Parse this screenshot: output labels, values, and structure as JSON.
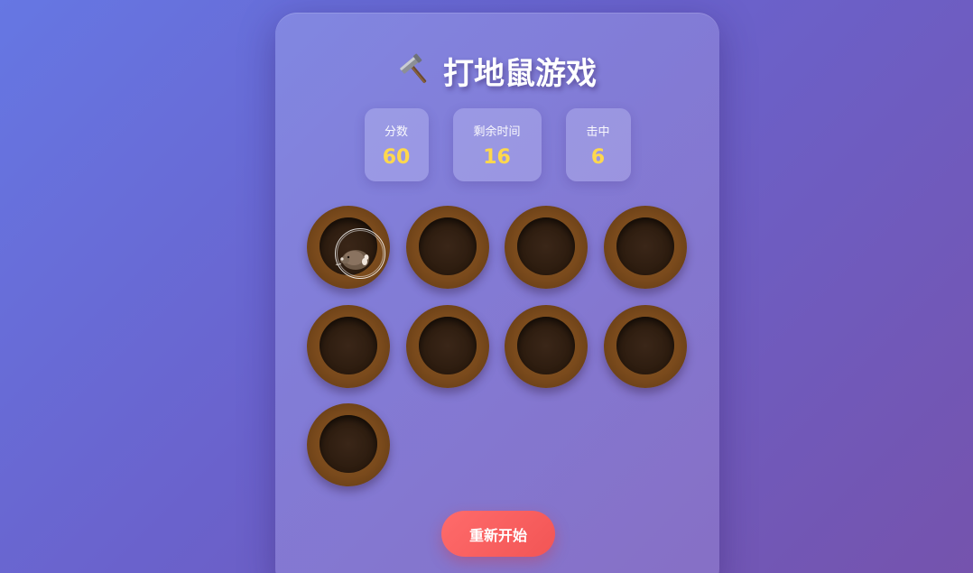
{
  "game": {
    "title": "打地鼠游戏",
    "title_icon": "hammer-icon"
  },
  "stats": [
    {
      "label": "分数",
      "value": "60"
    },
    {
      "label": "剩余时间",
      "value": "16"
    },
    {
      "label": "击中",
      "value": "6"
    }
  ],
  "board": {
    "hole_count": 9,
    "active_mole_hole": 1
  },
  "controls": {
    "restart_label": "重新开始"
  },
  "colors": {
    "accent_value": "#ffd84d",
    "restart_button": "#ff6b6b",
    "hole_rim": "#7a4a1c",
    "hole_pit": "#2e1d10"
  }
}
